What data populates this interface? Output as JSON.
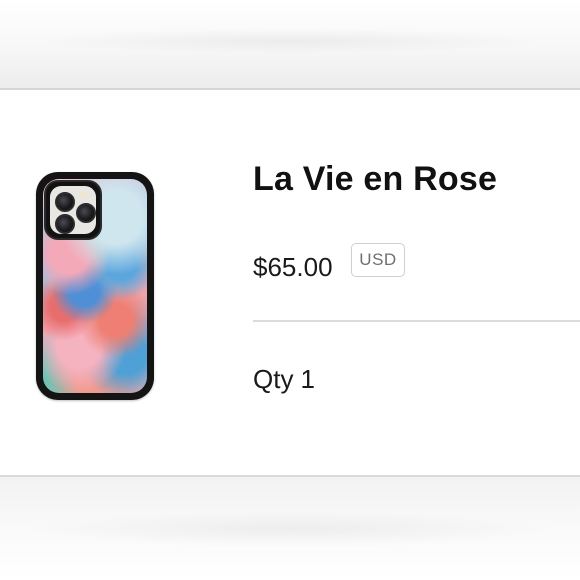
{
  "product": {
    "title": "La Vie en Rose",
    "price": "$65.00",
    "currency": "USD",
    "quantity_label": "Qty",
    "quantity_value": "1",
    "image": {
      "icon": "phone-case-image",
      "palette": [
        "#f7c4cf",
        "#5aa6dd",
        "#e86e6e",
        "#9fd1a6",
        "#141414"
      ]
    }
  },
  "colors": {
    "text": "#111111",
    "badge_border": "#cfcfcf",
    "badge_text": "#6f6f6f",
    "divider": "#dcdcdc"
  }
}
